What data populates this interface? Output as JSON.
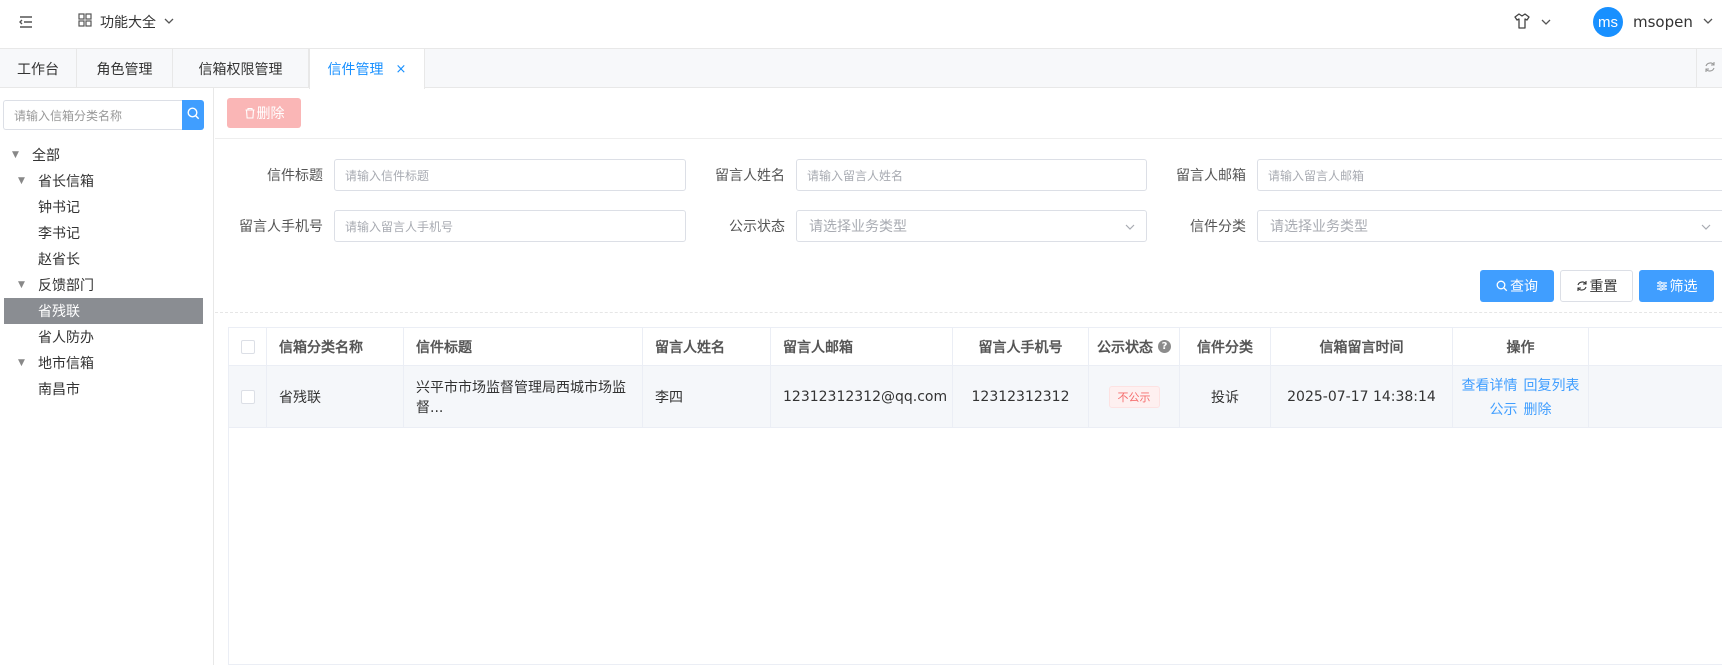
{
  "topbar": {
    "app_menu_label": "功能大全",
    "username": "msopen",
    "avatar_text": "ms"
  },
  "tabs": [
    {
      "label": "工作台"
    },
    {
      "label": "角色管理"
    },
    {
      "label": "信箱权限管理"
    },
    {
      "label": "信件管理",
      "close": "×"
    }
  ],
  "sidebar": {
    "search_placeholder": "请输入信箱分类名称",
    "tree": [
      {
        "label": "全部"
      },
      {
        "label": "省长信箱"
      },
      {
        "label": "钟书记"
      },
      {
        "label": "李书记"
      },
      {
        "label": "赵省长"
      },
      {
        "label": "反馈部门"
      },
      {
        "label": "省残联"
      },
      {
        "label": "省人防办"
      },
      {
        "label": "地市信箱"
      },
      {
        "label": "南昌市"
      }
    ]
  },
  "toolbar": {
    "delete_label": "删除"
  },
  "filters": {
    "title_label": "信件标题",
    "title_placeholder": "请输入信件标题",
    "name_label": "留言人姓名",
    "name_placeholder": "请输入留言人姓名",
    "email_label": "留言人邮箱",
    "email_placeholder": "请输入留言人邮箱",
    "phone_label": "留言人手机号",
    "phone_placeholder": "请输入留言人手机号",
    "public_label": "公示状态",
    "public_placeholder": "请选择业务类型",
    "category_label": "信件分类",
    "category_placeholder": "请选择业务类型",
    "query_label": "查询",
    "reset_label": "重置",
    "filter_label": "筛选"
  },
  "table": {
    "headers": [
      "信箱分类名称",
      "信件标题",
      "留言人姓名",
      "留言人邮箱",
      "留言人手机号",
      "公示状态",
      "信件分类",
      "信箱留言时间",
      "操作"
    ],
    "help_glyph": "?",
    "rows": [
      {
        "category_name": "省残联",
        "title": "兴平市市场监督管理局西城市场监督...",
        "name": "李四",
        "email": "12312312312@qq.com",
        "phone": "12312312312",
        "public_status": "不公示",
        "letter_type": "投诉",
        "time": "2025-07-17 14:38:14",
        "actions": {
          "detail": "查看详情",
          "reply": "回复列表",
          "publish": "公示",
          "delete": "删除"
        }
      }
    ]
  },
  "colors": {
    "primary": "#409eff",
    "danger_light": "#fab6b6",
    "selected_node": "#8a8d92"
  }
}
